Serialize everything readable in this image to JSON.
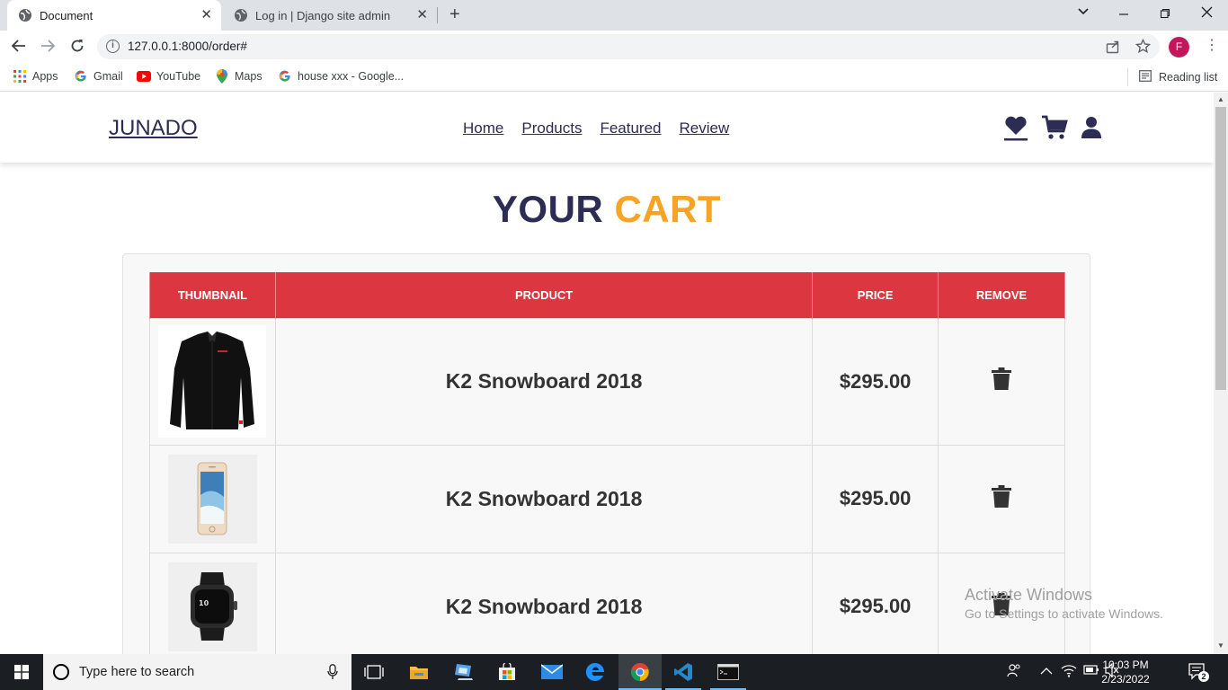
{
  "browser": {
    "tabs": [
      {
        "title": "Document",
        "active": true
      },
      {
        "title": "Log in | Django site admin",
        "active": false
      }
    ],
    "new_tab": "+",
    "url": "127.0.0.1:8000/order#",
    "profile_initial": "F",
    "bookmarks": [
      {
        "label": "Apps",
        "icon": "apps-grid-icon"
      },
      {
        "label": "Gmail",
        "icon": "google-g-icon"
      },
      {
        "label": "YouTube",
        "icon": "youtube-icon"
      },
      {
        "label": "Maps",
        "icon": "maps-pin-icon"
      },
      {
        "label": "house xxx - Google...",
        "icon": "google-g-icon"
      }
    ],
    "reading_list": "Reading list"
  },
  "site": {
    "logo": "JUNADO",
    "nav": [
      "Home",
      "Products",
      "Featured",
      "Review"
    ],
    "header_icons": [
      "heart-icon",
      "cart-icon",
      "user-icon"
    ],
    "title_part1": "YOUR",
    "title_part2": "CART",
    "accent_color": "#f7a325",
    "dark_color": "#2c2c54",
    "table_header_color": "#dc3741"
  },
  "cart": {
    "columns": [
      "THUMBNAIL",
      "PRODUCT",
      "PRICE",
      "REMOVE"
    ],
    "rows": [
      {
        "thumbnail": "black-shirt-image",
        "product": "K2 Snowboard 2018",
        "price": "$295.00"
      },
      {
        "thumbnail": "iphone-image",
        "product": "K2 Snowboard 2018",
        "price": "$295.00"
      },
      {
        "thumbnail": "smartwatch-image",
        "product": "K2 Snowboard 2018",
        "price": "$295.00"
      }
    ]
  },
  "watermark": {
    "line1": "Activate Windows",
    "line2": "Go to Settings to activate Windows."
  },
  "taskbar": {
    "search_placeholder": "Type here to search",
    "time": "10:03 PM",
    "date": "2/23/2022",
    "notification_count": "2"
  }
}
